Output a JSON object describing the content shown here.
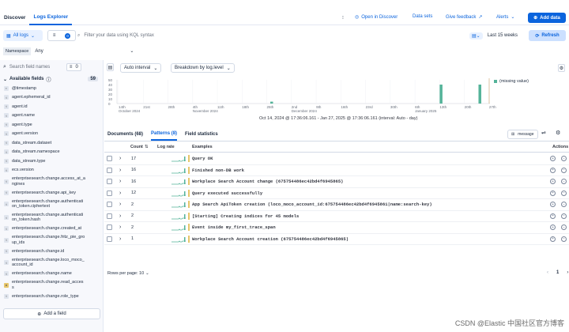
{
  "topbar": {
    "discover": "Discover",
    "logs_explorer": "Logs Explorer",
    "open_in_discover": "Open in Discover",
    "data_sets": "Data sets",
    "give_feedback": "Give feedback",
    "alerts": "Alerts",
    "add_data": "Add data"
  },
  "query": {
    "all_logs": "All logs",
    "filter_count": "0",
    "placeholder": "Filter your data using KQL syntax",
    "time_range": "Last 15 weeks",
    "refresh": "Refresh"
  },
  "namespace": {
    "label": "Namespace",
    "value": "Any"
  },
  "sidebar": {
    "search_placeholder": "Search field names",
    "filter_count": "0",
    "available_label": "Available fields",
    "available_count": "59",
    "add_field": "Add a field",
    "fields": [
      {
        "type": "date",
        "name": "@timestamp"
      },
      {
        "type": "t",
        "name": "agent.ephemeral_id"
      },
      {
        "type": "t",
        "name": "agent.id"
      },
      {
        "type": "t",
        "name": "agent.name"
      },
      {
        "type": "t",
        "name": "agent.type"
      },
      {
        "type": "t",
        "name": "agent.version"
      },
      {
        "type": "t",
        "name": "data_stream.dataset"
      },
      {
        "type": "t",
        "name": "data_stream.namespace"
      },
      {
        "type": "t",
        "name": "data_stream.type"
      },
      {
        "type": "t",
        "name": "ecs.version"
      },
      {
        "type": "t",
        "name": "enterprisesearch.change.access_at_a\nngines"
      },
      {
        "type": "t",
        "name": "enterprisesearch.change.api_key"
      },
      {
        "type": "t",
        "name": "enterprisesearch.change.authenticati\non_token.ciphertext"
      },
      {
        "type": "t",
        "name": "enterprisesearch.change.authenticati\non_token.hash"
      },
      {
        "type": "t",
        "name": "enterprisesearch.change.created_at"
      },
      {
        "type": "t",
        "name": "enterprisesearch.change.fritz_pie_gro\nup_ids"
      },
      {
        "type": "t",
        "name": "enterprisesearch.change.id"
      },
      {
        "type": "t",
        "name": "enterprisesearch.change.loco_moco_\naccount_id"
      },
      {
        "type": "t",
        "name": "enterprisesearch.change.name"
      },
      {
        "type": "geo",
        "name": "enterprisesearch.change.read_acces\ns"
      },
      {
        "type": "t",
        "name": "enterprisesearch.change.role_type"
      }
    ]
  },
  "chart": {
    "interval": "Auto interval",
    "breakdown": "Breakdown by log.level",
    "legend": "(missing value)",
    "range": "Oct 14, 2024 @ 17:36:06.161 - Jan 27, 2025 @ 17:36:06.161 (interval: Auto - day)"
  },
  "chart_data": {
    "type": "bar",
    "series": [
      {
        "name": "(missing value)",
        "values": [
          {
            "x": "Nov 26, 2024",
            "y": 4
          },
          {
            "x": "Jan 13, 2025",
            "y": 40
          },
          {
            "x": "Jan 24, 2025",
            "y": 40
          }
        ]
      }
    ],
    "ylim": [
      0,
      50
    ],
    "yticks": [
      "0",
      "10",
      "20",
      "30",
      "40",
      "50"
    ],
    "xticks": [
      "14th\nOctober 2024",
      "21st",
      "28th",
      "4th\nNovember 2024",
      "11th",
      "18th",
      "25th",
      "2nd\nDecember 2024",
      "9th",
      "16th",
      "23rd",
      "30th",
      "6th\nJanuary 2025",
      "13th",
      "20th",
      "27th"
    ]
  },
  "tabs": {
    "documents": "Documents (68)",
    "patterns": "Patterns (8)",
    "field_statistics": "Field statistics",
    "message": "message"
  },
  "table": {
    "col_count": "Count",
    "col_lograte": "Log rate",
    "col_examples": "Examples",
    "col_actions": "Actions",
    "rows": [
      {
        "count": "17",
        "example": "Query OK"
      },
      {
        "count": "16",
        "example": "Finished non-DB work"
      },
      {
        "count": "16",
        "example": "Workplace Search Account change (675754486ec42bd4f6945865)"
      },
      {
        "count": "12",
        "example": "Query executed successfully"
      },
      {
        "count": "2",
        "example": "App Search ApiToken creation (loco_moco_account_id:675754486ec42bd4f6945861|name:search-key)"
      },
      {
        "count": "2",
        "example": "[Starting] Creating indices for 45 models"
      },
      {
        "count": "2",
        "example": "Event inside my_first_trace_span"
      },
      {
        "count": "1",
        "example": "Workplace Search Account creation (675754486ec42bd4f6945865)"
      }
    ]
  },
  "pagination": {
    "rows_per_page": "Rows per page: 10",
    "page": "1"
  },
  "watermark": "CSDN @Elastic 中国社区官方博客",
  "colors": {
    "accent": "#0b64dd",
    "bar": "#54b399"
  }
}
